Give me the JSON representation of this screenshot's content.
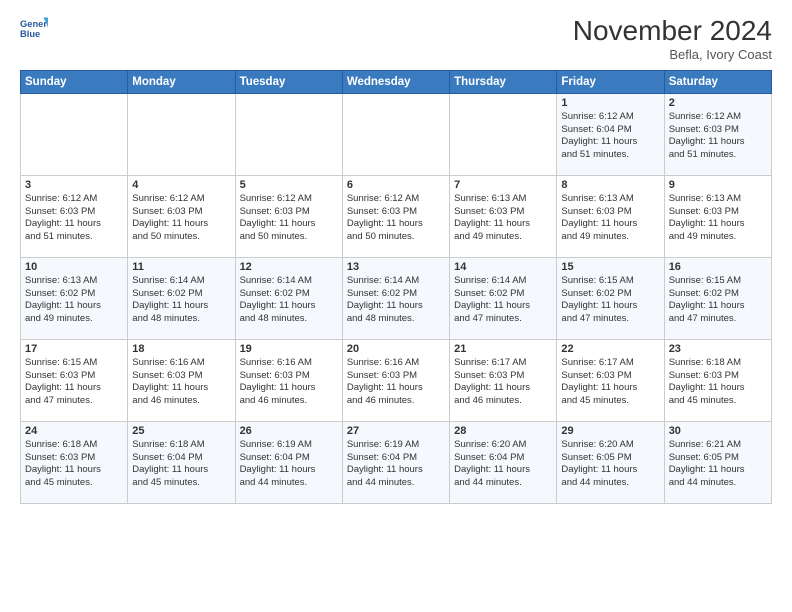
{
  "logo": {
    "line1": "General",
    "line2": "Blue"
  },
  "title": "November 2024",
  "subtitle": "Befla, Ivory Coast",
  "days_header": [
    "Sunday",
    "Monday",
    "Tuesday",
    "Wednesday",
    "Thursday",
    "Friday",
    "Saturday"
  ],
  "weeks": [
    [
      {
        "day": "",
        "info": ""
      },
      {
        "day": "",
        "info": ""
      },
      {
        "day": "",
        "info": ""
      },
      {
        "day": "",
        "info": ""
      },
      {
        "day": "",
        "info": ""
      },
      {
        "day": "1",
        "info": "Sunrise: 6:12 AM\nSunset: 6:04 PM\nDaylight: 11 hours\nand 51 minutes."
      },
      {
        "day": "2",
        "info": "Sunrise: 6:12 AM\nSunset: 6:03 PM\nDaylight: 11 hours\nand 51 minutes."
      }
    ],
    [
      {
        "day": "3",
        "info": "Sunrise: 6:12 AM\nSunset: 6:03 PM\nDaylight: 11 hours\nand 51 minutes."
      },
      {
        "day": "4",
        "info": "Sunrise: 6:12 AM\nSunset: 6:03 PM\nDaylight: 11 hours\nand 50 minutes."
      },
      {
        "day": "5",
        "info": "Sunrise: 6:12 AM\nSunset: 6:03 PM\nDaylight: 11 hours\nand 50 minutes."
      },
      {
        "day": "6",
        "info": "Sunrise: 6:12 AM\nSunset: 6:03 PM\nDaylight: 11 hours\nand 50 minutes."
      },
      {
        "day": "7",
        "info": "Sunrise: 6:13 AM\nSunset: 6:03 PM\nDaylight: 11 hours\nand 49 minutes."
      },
      {
        "day": "8",
        "info": "Sunrise: 6:13 AM\nSunset: 6:03 PM\nDaylight: 11 hours\nand 49 minutes."
      },
      {
        "day": "9",
        "info": "Sunrise: 6:13 AM\nSunset: 6:03 PM\nDaylight: 11 hours\nand 49 minutes."
      }
    ],
    [
      {
        "day": "10",
        "info": "Sunrise: 6:13 AM\nSunset: 6:02 PM\nDaylight: 11 hours\nand 49 minutes."
      },
      {
        "day": "11",
        "info": "Sunrise: 6:14 AM\nSunset: 6:02 PM\nDaylight: 11 hours\nand 48 minutes."
      },
      {
        "day": "12",
        "info": "Sunrise: 6:14 AM\nSunset: 6:02 PM\nDaylight: 11 hours\nand 48 minutes."
      },
      {
        "day": "13",
        "info": "Sunrise: 6:14 AM\nSunset: 6:02 PM\nDaylight: 11 hours\nand 48 minutes."
      },
      {
        "day": "14",
        "info": "Sunrise: 6:14 AM\nSunset: 6:02 PM\nDaylight: 11 hours\nand 47 minutes."
      },
      {
        "day": "15",
        "info": "Sunrise: 6:15 AM\nSunset: 6:02 PM\nDaylight: 11 hours\nand 47 minutes."
      },
      {
        "day": "16",
        "info": "Sunrise: 6:15 AM\nSunset: 6:02 PM\nDaylight: 11 hours\nand 47 minutes."
      }
    ],
    [
      {
        "day": "17",
        "info": "Sunrise: 6:15 AM\nSunset: 6:03 PM\nDaylight: 11 hours\nand 47 minutes."
      },
      {
        "day": "18",
        "info": "Sunrise: 6:16 AM\nSunset: 6:03 PM\nDaylight: 11 hours\nand 46 minutes."
      },
      {
        "day": "19",
        "info": "Sunrise: 6:16 AM\nSunset: 6:03 PM\nDaylight: 11 hours\nand 46 minutes."
      },
      {
        "day": "20",
        "info": "Sunrise: 6:16 AM\nSunset: 6:03 PM\nDaylight: 11 hours\nand 46 minutes."
      },
      {
        "day": "21",
        "info": "Sunrise: 6:17 AM\nSunset: 6:03 PM\nDaylight: 11 hours\nand 46 minutes."
      },
      {
        "day": "22",
        "info": "Sunrise: 6:17 AM\nSunset: 6:03 PM\nDaylight: 11 hours\nand 45 minutes."
      },
      {
        "day": "23",
        "info": "Sunrise: 6:18 AM\nSunset: 6:03 PM\nDaylight: 11 hours\nand 45 minutes."
      }
    ],
    [
      {
        "day": "24",
        "info": "Sunrise: 6:18 AM\nSunset: 6:03 PM\nDaylight: 11 hours\nand 45 minutes."
      },
      {
        "day": "25",
        "info": "Sunrise: 6:18 AM\nSunset: 6:04 PM\nDaylight: 11 hours\nand 45 minutes."
      },
      {
        "day": "26",
        "info": "Sunrise: 6:19 AM\nSunset: 6:04 PM\nDaylight: 11 hours\nand 44 minutes."
      },
      {
        "day": "27",
        "info": "Sunrise: 6:19 AM\nSunset: 6:04 PM\nDaylight: 11 hours\nand 44 minutes."
      },
      {
        "day": "28",
        "info": "Sunrise: 6:20 AM\nSunset: 6:04 PM\nDaylight: 11 hours\nand 44 minutes."
      },
      {
        "day": "29",
        "info": "Sunrise: 6:20 AM\nSunset: 6:05 PM\nDaylight: 11 hours\nand 44 minutes."
      },
      {
        "day": "30",
        "info": "Sunrise: 6:21 AM\nSunset: 6:05 PM\nDaylight: 11 hours\nand 44 minutes."
      }
    ]
  ]
}
